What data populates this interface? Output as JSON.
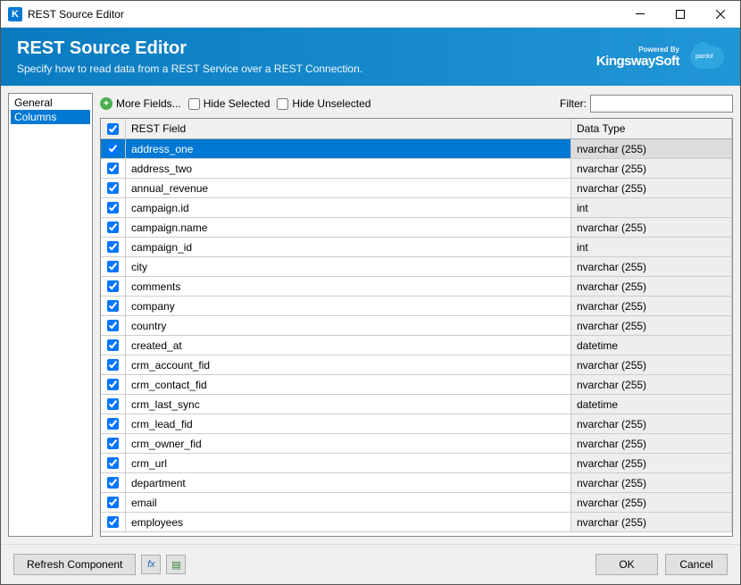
{
  "window": {
    "title": "REST Source Editor",
    "icon_letter": "K"
  },
  "header": {
    "title": "REST Source Editor",
    "subtitle": "Specify how to read data from a REST Service over a REST Connection.",
    "powered_by": "Powered By",
    "brand": "KingswaySoft"
  },
  "sidebar": {
    "items": [
      "General",
      "Columns"
    ],
    "selected": "Columns"
  },
  "toolbar": {
    "more_fields": "More Fields...",
    "hide_selected": "Hide Selected",
    "hide_unselected": "Hide Unselected",
    "filter_label": "Filter:",
    "filter_value": ""
  },
  "grid": {
    "col_field": "REST Field",
    "col_type": "Data Type",
    "rows": [
      {
        "field": "address_one",
        "type": "nvarchar (255)",
        "checked": true,
        "selected": true
      },
      {
        "field": "address_two",
        "type": "nvarchar (255)",
        "checked": true
      },
      {
        "field": "annual_revenue",
        "type": "nvarchar (255)",
        "checked": true
      },
      {
        "field": "campaign.id",
        "type": "int",
        "checked": true
      },
      {
        "field": "campaign.name",
        "type": "nvarchar (255)",
        "checked": true
      },
      {
        "field": "campaign_id",
        "type": "int",
        "checked": true
      },
      {
        "field": "city",
        "type": "nvarchar (255)",
        "checked": true
      },
      {
        "field": "comments",
        "type": "nvarchar (255)",
        "checked": true
      },
      {
        "field": "company",
        "type": "nvarchar (255)",
        "checked": true
      },
      {
        "field": "country",
        "type": "nvarchar (255)",
        "checked": true
      },
      {
        "field": "created_at",
        "type": "datetime",
        "checked": true
      },
      {
        "field": "crm_account_fid",
        "type": "nvarchar (255)",
        "checked": true
      },
      {
        "field": "crm_contact_fid",
        "type": "nvarchar (255)",
        "checked": true
      },
      {
        "field": "crm_last_sync",
        "type": "datetime",
        "checked": true
      },
      {
        "field": "crm_lead_fid",
        "type": "nvarchar (255)",
        "checked": true
      },
      {
        "field": "crm_owner_fid",
        "type": "nvarchar (255)",
        "checked": true
      },
      {
        "field": "crm_url",
        "type": "nvarchar (255)",
        "checked": true
      },
      {
        "field": "department",
        "type": "nvarchar (255)",
        "checked": true
      },
      {
        "field": "email",
        "type": "nvarchar (255)",
        "checked": true
      },
      {
        "field": "employees",
        "type": "nvarchar (255)",
        "checked": true
      }
    ]
  },
  "footer": {
    "refresh": "Refresh Component",
    "ok": "OK",
    "cancel": "Cancel"
  }
}
